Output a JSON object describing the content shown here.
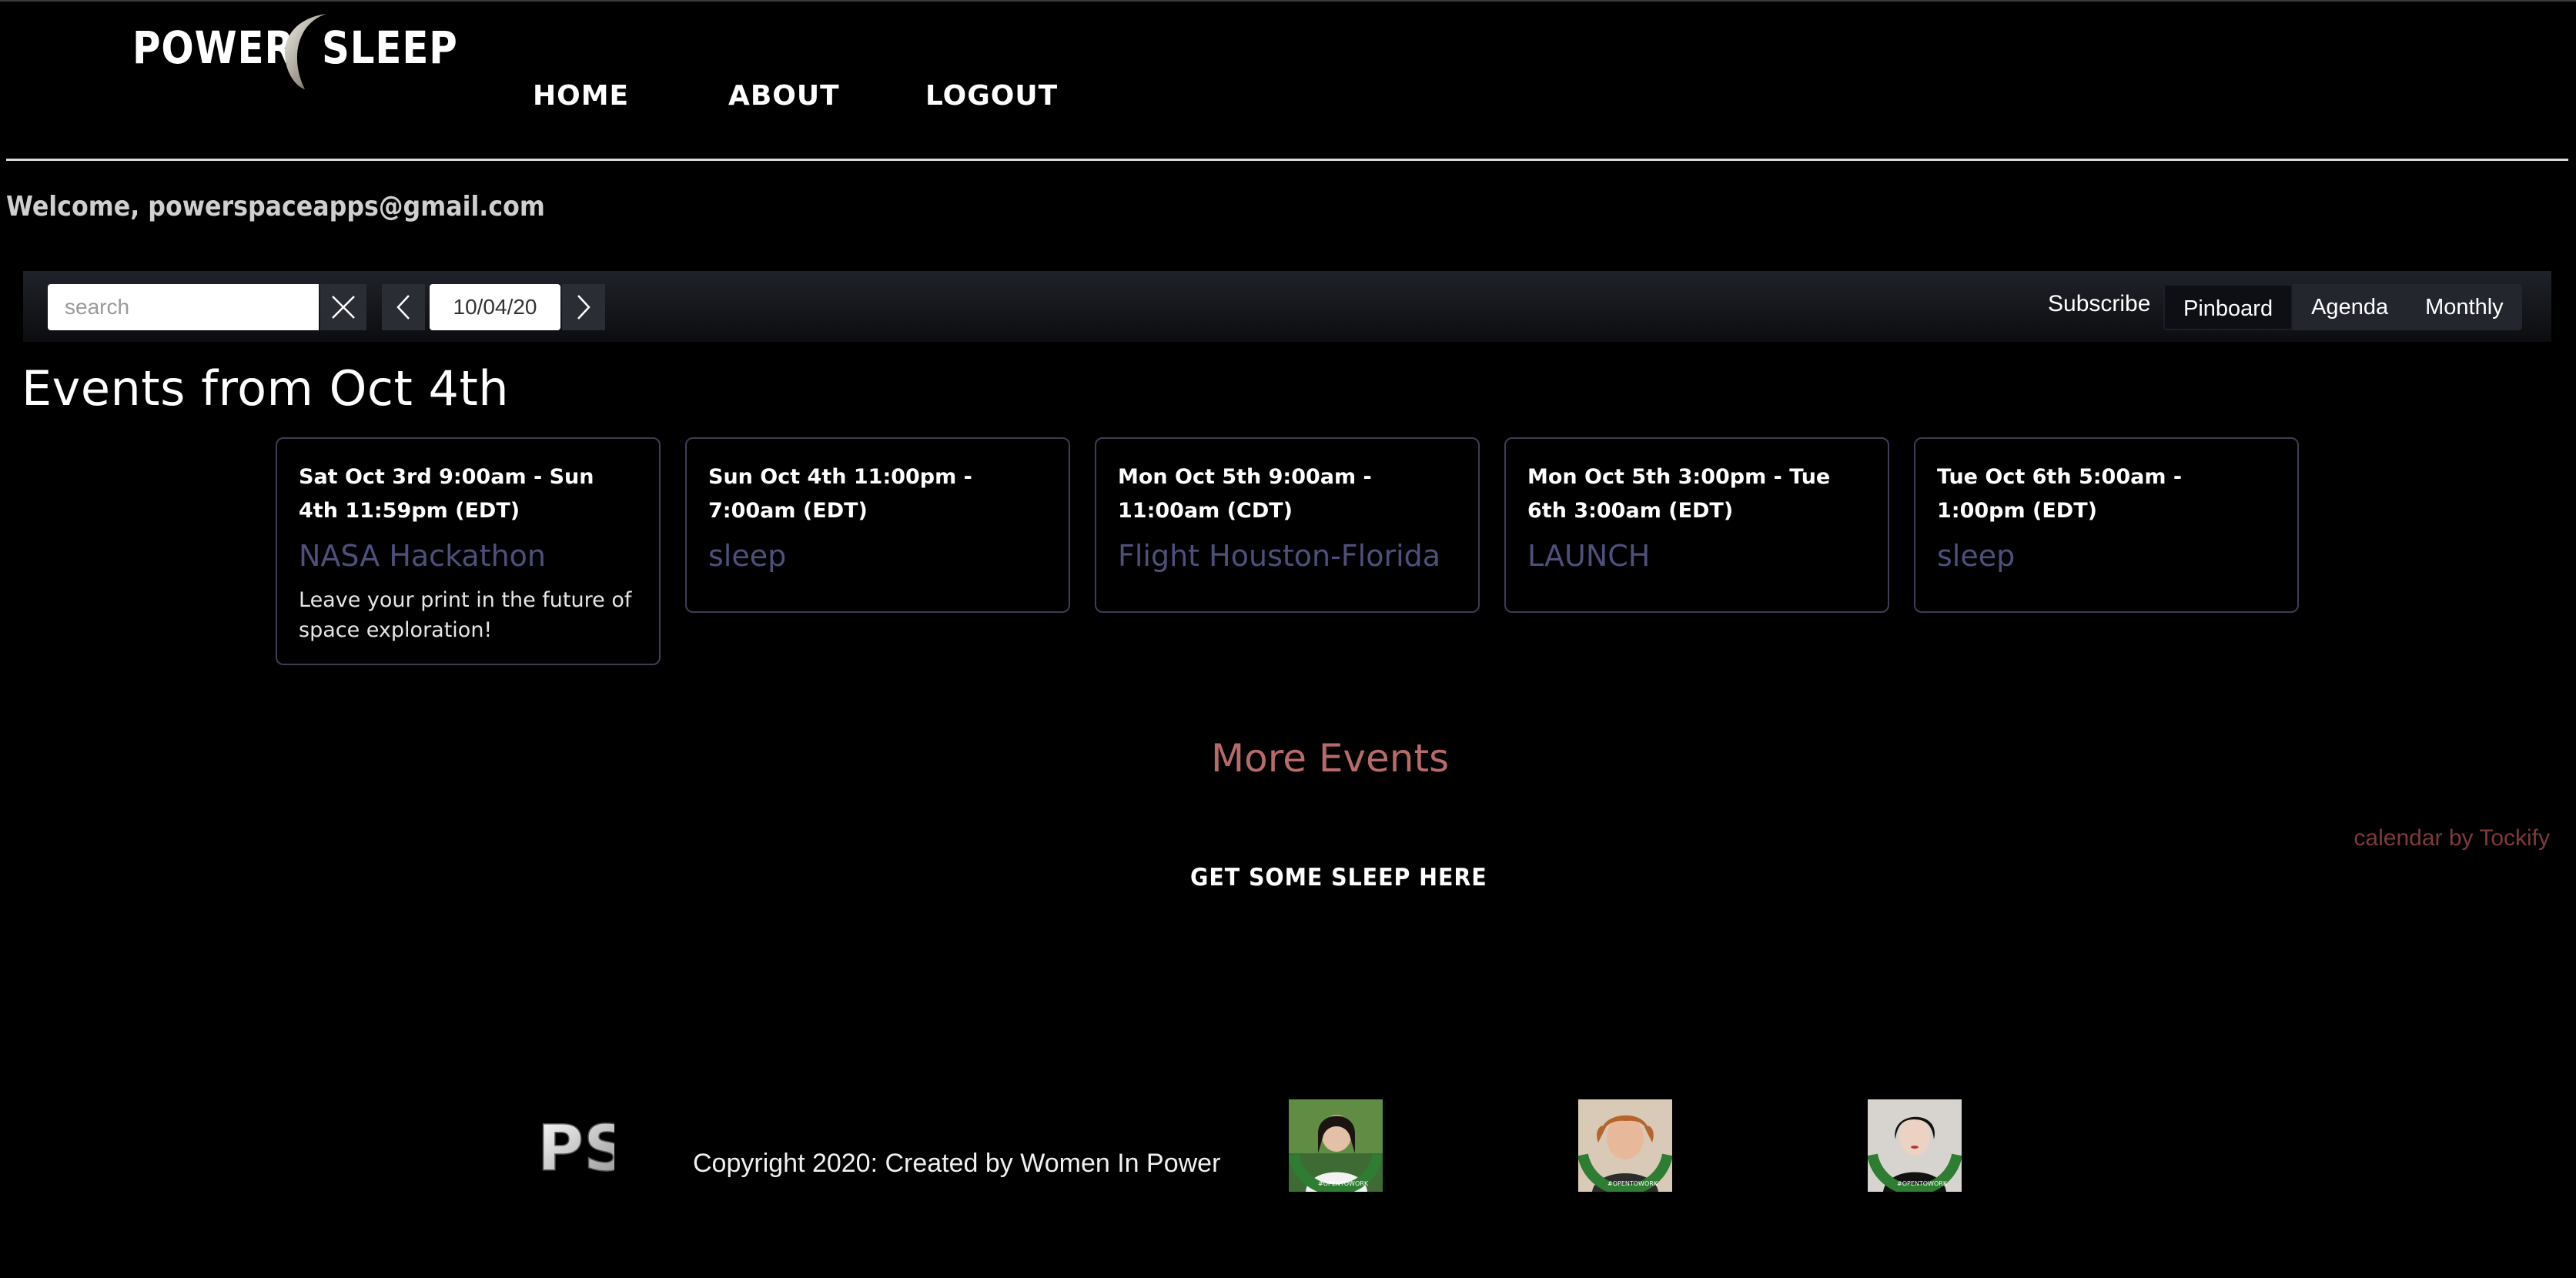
{
  "header": {
    "logo_word_1": "POWER",
    "logo_word_2": "SLEEP",
    "nav": [
      "HOME",
      "ABOUT",
      "LOGOUT"
    ]
  },
  "welcome": "Welcome, powerspaceapps@gmail.com",
  "toolbar": {
    "search_placeholder": "search",
    "date": "10/04/20",
    "subscribe": "Subscribe",
    "views": [
      "Pinboard",
      "Agenda",
      "Monthly"
    ],
    "active_view": "Pinboard"
  },
  "events_title": "Events from Oct 4th",
  "events": [
    {
      "when": "Sat Oct 3rd 9:00am - Sun 4th 11:59pm (EDT)",
      "title": "NASA Hackathon",
      "description": "Leave your print in the future of space exploration!"
    },
    {
      "when": "Sun Oct 4th 11:00pm - 7:00am (EDT)",
      "title": "sleep",
      "description": ""
    },
    {
      "when": "Mon Oct 5th 9:00am - 11:00am (CDT)",
      "title": "Flight Houston-Florida",
      "description": ""
    },
    {
      "when": "Mon Oct 5th 3:00pm - Tue 6th 3:00am (EDT)",
      "title": "LAUNCH",
      "description": ""
    },
    {
      "when": "Tue Oct 6th 5:00am - 1:00pm (EDT)",
      "title": "sleep",
      "description": ""
    }
  ],
  "more_events": "More Events",
  "credit": "calendar by Tockify",
  "sleep_link": "GET SOME SLEEP HERE",
  "footer": {
    "logo_text": "PS",
    "copyright": "Copyright 2020: Created by Women In Power",
    "avatar_badge": "#OPENTOWORK"
  },
  "colors": {
    "event_title": "#4e4f7b",
    "more_events": "#b86a6a",
    "credit": "#7d3b3b",
    "card_border": "#3b3e55"
  }
}
